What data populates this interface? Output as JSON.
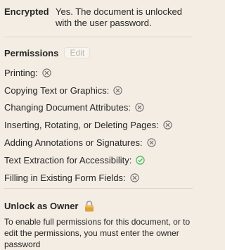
{
  "encryption": {
    "label": "Encrypted",
    "value": "Yes. The document is unlocked with the user password."
  },
  "permissions": {
    "title": "Permissions",
    "edit_label": "Edit",
    "items": [
      {
        "label": "Printing:",
        "allowed": false,
        "icon": "x-circle-icon"
      },
      {
        "label": "Copying Text or Graphics:",
        "allowed": false,
        "icon": "x-circle-icon"
      },
      {
        "label": "Changing Document Attributes:",
        "allowed": false,
        "icon": "x-circle-icon"
      },
      {
        "label": "Inserting, Rotating, or Deleting Pages:",
        "allowed": false,
        "icon": "x-circle-icon"
      },
      {
        "label": "Adding Annotations or Signatures:",
        "allowed": false,
        "icon": "x-circle-icon"
      },
      {
        "label": "Text Extraction for Accessibility:",
        "allowed": true,
        "icon": "checkmark-circle-icon"
      },
      {
        "label": "Filling in Existing Form Fields:",
        "allowed": false,
        "icon": "x-circle-icon"
      }
    ]
  },
  "unlock": {
    "title": "Unlock as Owner",
    "icon": "lock-icon",
    "description": "To enable full permissions for this document, or to edit the permissions, you must enter the owner password"
  },
  "colors": {
    "background": "#f3ede4",
    "denied": "#6e6e6e",
    "allowed": "#34b84a",
    "lock": "#e0a23b"
  }
}
